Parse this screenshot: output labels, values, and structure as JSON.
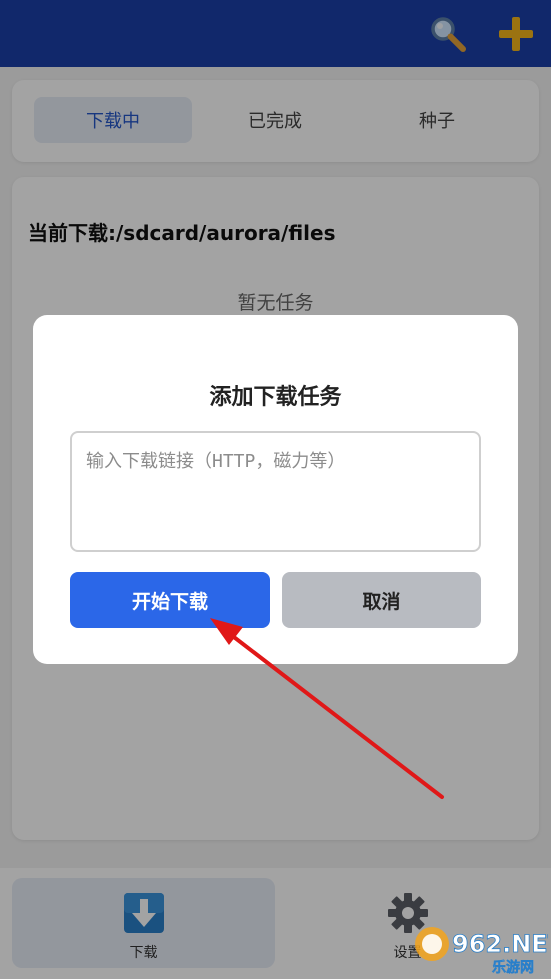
{
  "app_bar": {
    "color": "#1b3fa8",
    "actions": [
      {
        "icon": "search-icon"
      },
      {
        "icon": "plus-icon",
        "color": "#f2b51c"
      }
    ]
  },
  "tabs": [
    {
      "label": "下载中",
      "active": true
    },
    {
      "label": "已完成",
      "active": false
    },
    {
      "label": "种子",
      "active": false
    }
  ],
  "content": {
    "download_path": "当前下载:/sdcard/aurora/files",
    "empty_text": "暂无任务"
  },
  "dialog": {
    "title": "添加下载任务",
    "input_value": "",
    "input_placeholder": "输入下载链接（HTTP，磁力等）",
    "start_label": "开始下载",
    "cancel_label": "取消",
    "start_color": "#2b67e8"
  },
  "bottom_nav": [
    {
      "label": "下载",
      "icon": "download-arrow-icon",
      "active": true
    },
    {
      "label": "设置",
      "icon": "gear-icon",
      "active": false
    }
  ],
  "watermark": {
    "brand": "962.NET",
    "sub": "乐游网"
  }
}
